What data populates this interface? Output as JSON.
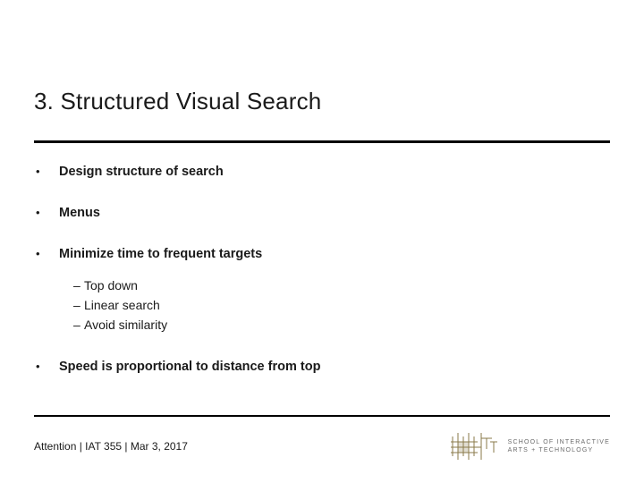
{
  "title": "3. Structured Visual Search",
  "bullets": {
    "b0": "Design structure of search",
    "b1": "Menus",
    "b2": "Minimize time to frequent targets",
    "b2_sub": {
      "s0": "Top down",
      "s1": "Linear search",
      "s2": "Avoid similarity"
    },
    "b3": "Speed is proportional to distance from top"
  },
  "footer": {
    "text": "Attention | IAT 355  |  Mar 3, 2017",
    "institution_line1": "SCHOOL OF INTERACTIVE",
    "institution_line2": "ARTS + TECHNOLOGY"
  }
}
